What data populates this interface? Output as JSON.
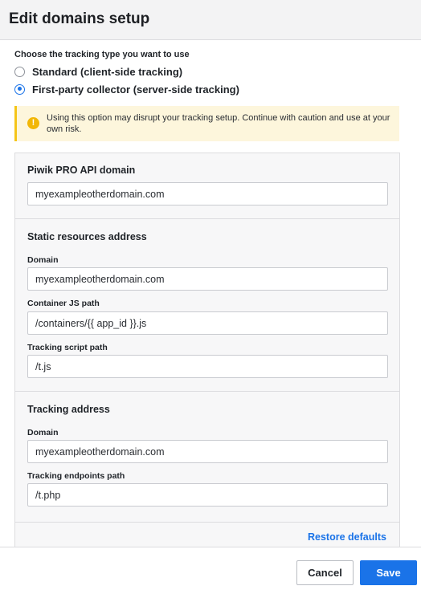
{
  "dialog": {
    "title": "Edit domains setup"
  },
  "tracking_type": {
    "label": "Choose the tracking type you want to use",
    "options": [
      {
        "label": "Standard (client-side tracking)",
        "selected": false
      },
      {
        "label": "First-party collector (server-side tracking)",
        "selected": true
      }
    ]
  },
  "warning": {
    "icon": "warning-icon",
    "text": "Using this option may disrupt your tracking setup. Continue with caution and use at your own risk."
  },
  "api_domain": {
    "title": "Piwik PRO API domain",
    "value": "myexampleotherdomain.com"
  },
  "static_resources": {
    "title": "Static resources address",
    "domain_label": "Domain",
    "domain_value": "myexampleotherdomain.com",
    "container_label": "Container JS path",
    "container_value": "/containers/{{ app_id }}.js",
    "script_label": "Tracking script path",
    "script_value": "/t.js"
  },
  "tracking_address": {
    "title": "Tracking address",
    "domain_label": "Domain",
    "domain_value": "myexampleotherdomain.com",
    "endpoints_label": "Tracking endpoints path",
    "endpoints_value": "/t.php"
  },
  "restore_label": "Restore defaults",
  "footer": {
    "cancel_label": "Cancel",
    "save_label": "Save"
  },
  "colors": {
    "accent": "#1a73e8",
    "warning_bg": "#fdf6dc",
    "warning_icon": "#f2b707"
  }
}
